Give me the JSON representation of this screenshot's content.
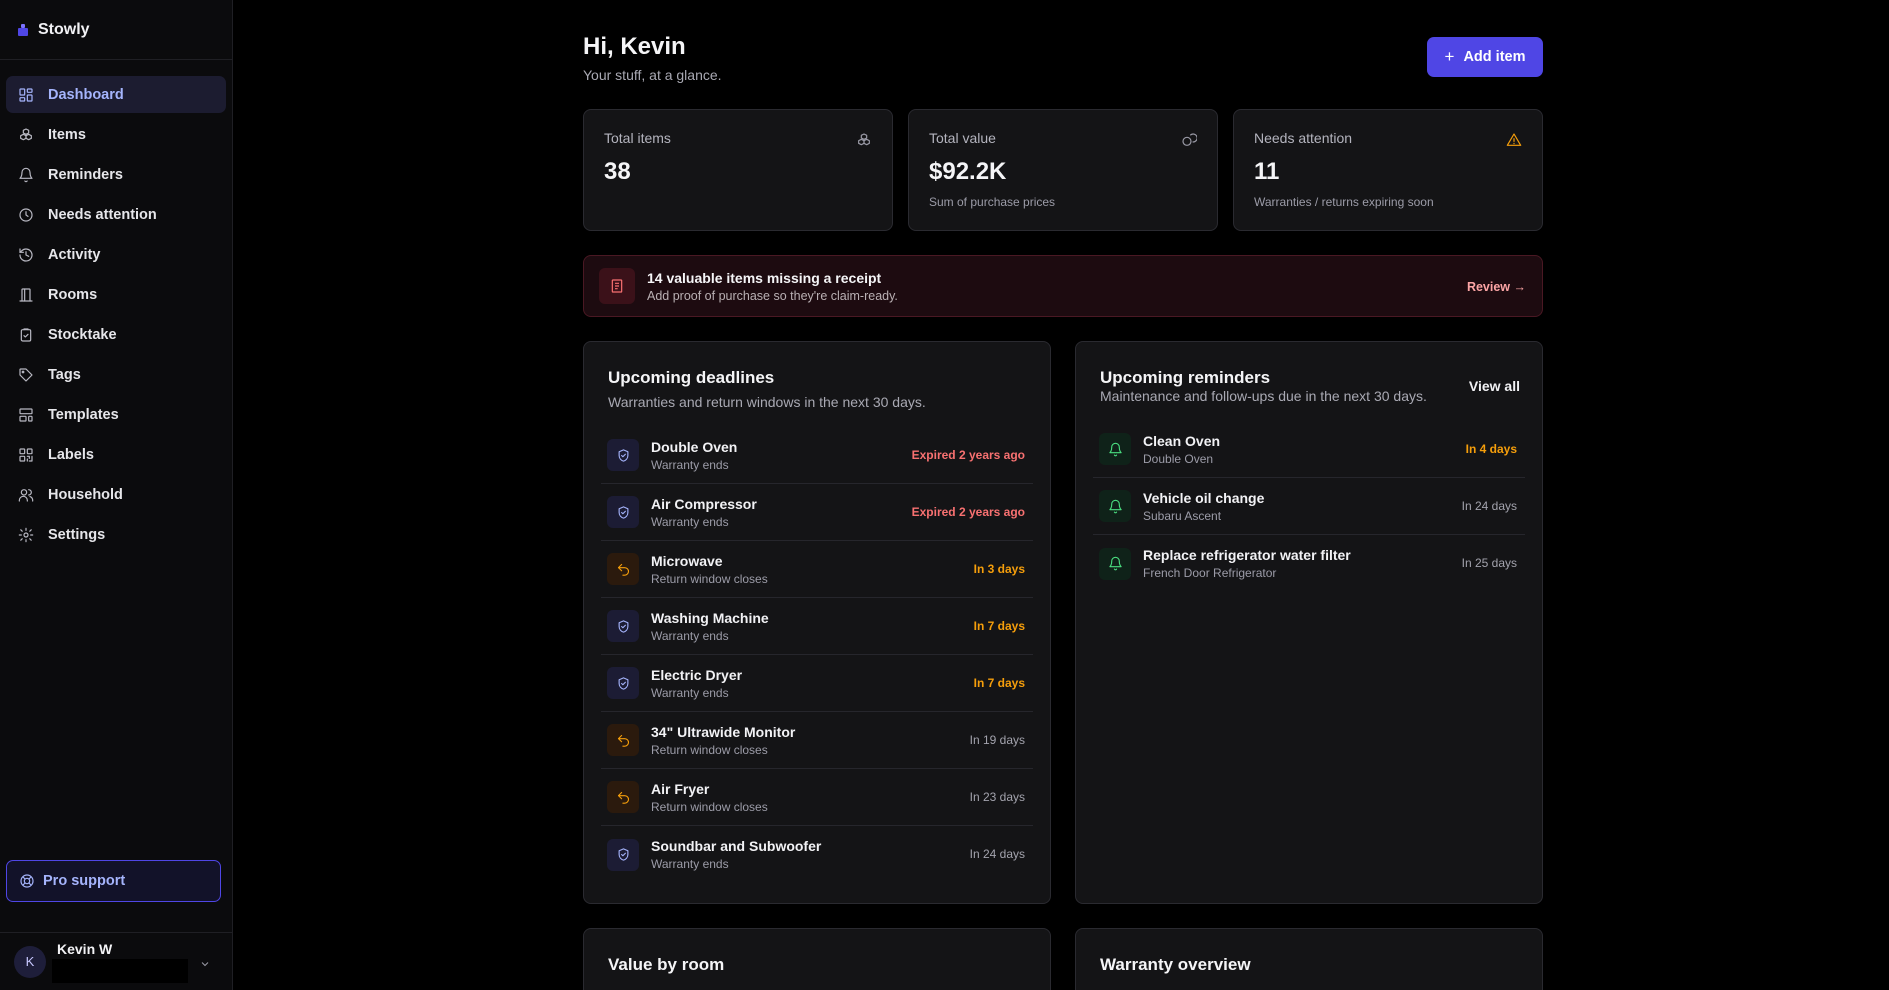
{
  "brand": {
    "name": "Stowly"
  },
  "sidebar": {
    "items": [
      {
        "label": "Dashboard",
        "icon": "grid-icon"
      },
      {
        "label": "Items",
        "icon": "boxes-icon"
      },
      {
        "label": "Reminders",
        "icon": "bell-icon"
      },
      {
        "label": "Needs attention",
        "icon": "clock-icon"
      },
      {
        "label": "Activity",
        "icon": "history-icon"
      },
      {
        "label": "Rooms",
        "icon": "door-icon"
      },
      {
        "label": "Stocktake",
        "icon": "clipboard-check-icon"
      },
      {
        "label": "Tags",
        "icon": "tag-icon"
      },
      {
        "label": "Templates",
        "icon": "layout-template-icon"
      },
      {
        "label": "Labels",
        "icon": "qr-code-icon"
      },
      {
        "label": "Household",
        "icon": "users-icon"
      },
      {
        "label": "Settings",
        "icon": "gear-icon"
      }
    ],
    "active_index": 0,
    "pro_support": "Pro support",
    "user": {
      "initial": "K",
      "name": "Kevin W"
    }
  },
  "header": {
    "greeting": "Hi, Kevin",
    "subtitle": "Your stuff, at a glance.",
    "add_button": "Add item"
  },
  "stats": [
    {
      "label": "Total items",
      "value": "38",
      "sub": ""
    },
    {
      "label": "Total value",
      "value": "$92.2K",
      "sub": "Sum of purchase prices"
    },
    {
      "label": "Needs attention",
      "value": "11",
      "sub": "Warranties / returns expiring soon"
    }
  ],
  "alert": {
    "title": "14 valuable items missing a receipt",
    "subtitle": "Add proof of purchase so they're claim-ready.",
    "link": "Review →"
  },
  "deadlines": {
    "title": "Upcoming deadlines",
    "subtitle": "Warranties and return windows in the next 30 days.",
    "rows": [
      {
        "name": "Double Oven",
        "sub": "Warranty ends",
        "status": "Expired 2 years ago"
      },
      {
        "name": "Air Compressor",
        "sub": "Warranty ends",
        "status": "Expired 2 years ago"
      },
      {
        "name": "Microwave",
        "sub": "Return window closes",
        "status": "In 3 days"
      },
      {
        "name": "Washing Machine",
        "sub": "Warranty ends",
        "status": "In 7 days"
      },
      {
        "name": "Electric Dryer",
        "sub": "Warranty ends",
        "status": "In 7 days"
      },
      {
        "name": "34\" Ultrawide Monitor",
        "sub": "Return window closes",
        "status": "In 19 days"
      },
      {
        "name": "Air Fryer",
        "sub": "Return window closes",
        "status": "In 23 days"
      },
      {
        "name": "Soundbar and Subwoofer",
        "sub": "Warranty ends",
        "status": "In 24 days"
      }
    ]
  },
  "reminders": {
    "title": "Upcoming reminders",
    "subtitle": "Maintenance and follow-ups due in the next 30 days.",
    "view_all": "View all",
    "rows": [
      {
        "name": "Clean Oven",
        "sub": "Double Oven",
        "status": "In 4 days"
      },
      {
        "name": "Vehicle oil change",
        "sub": "Subaru Ascent",
        "status": "In 24 days"
      },
      {
        "name": "Replace refrigerator water filter",
        "sub": "French Door Refrigerator",
        "status": "In 25 days"
      }
    ]
  },
  "bottom_panels": {
    "value_by_room": "Value by room",
    "warranty_overview": "Warranty overview"
  },
  "colors": {
    "accent": "#4f46e5",
    "accent_text": "#a5b4fc",
    "expired": "#f87171",
    "soon": "#f59e0b",
    "reminder": "#4ade80",
    "alert_bg": "#1d0b10"
  }
}
